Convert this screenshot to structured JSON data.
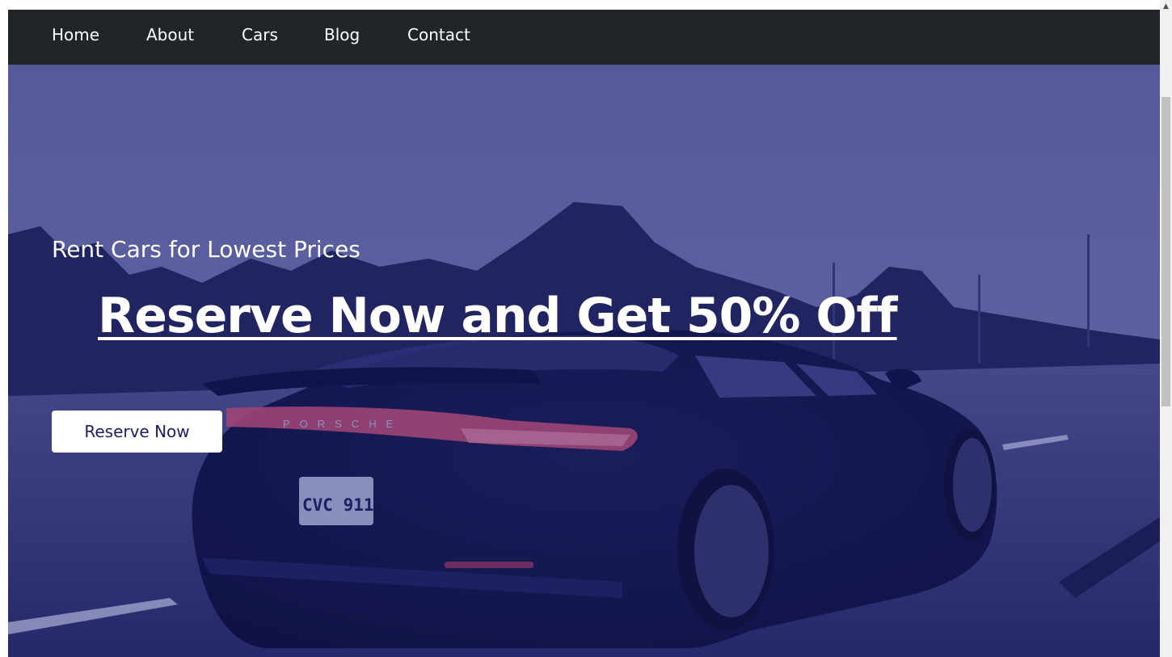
{
  "nav": {
    "items": [
      {
        "label": "Home"
      },
      {
        "label": "About"
      },
      {
        "label": "Cars"
      },
      {
        "label": "Blog"
      },
      {
        "label": "Contact"
      }
    ]
  },
  "hero": {
    "subtitle": "Rent Cars for Lowest Prices",
    "title": "Reserve Now and Get 50% Off",
    "button_label": "Reserve Now",
    "plate_text": "CVC 911",
    "badge_text": "PORSCHE"
  },
  "colors": {
    "navbar_bg": "#212529",
    "hero_tint": "#4b528f",
    "button_text": "#1b1f5e"
  }
}
